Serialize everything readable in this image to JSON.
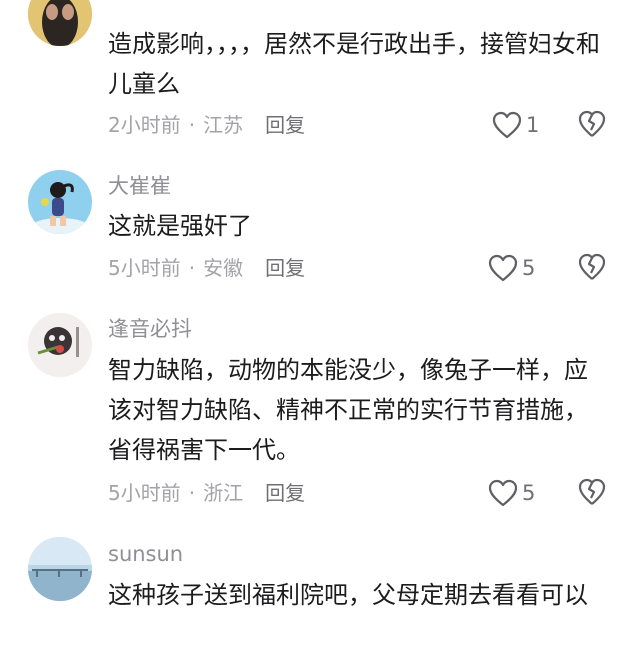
{
  "comments": [
    {
      "username": "",
      "text": "造成影响，，，，居然不是行政出手，接管妇女和儿童么",
      "time": "2小时前",
      "location": "江苏",
      "reply": "回复",
      "likes": "1"
    },
    {
      "username": "大崔崔",
      "text": "这就是强奸了",
      "time": "5小时前",
      "location": "安徽",
      "reply": "回复",
      "likes": "5"
    },
    {
      "username": "逢音必抖",
      "text": "智力缺陷，动物的本能没少，像兔子一样，应该对智力缺陷、精神不正常的实行节育措施，省得祸害下一代。",
      "time": "5小时前",
      "location": "浙江",
      "reply": "回复",
      "likes": "5"
    },
    {
      "username": "sunsun",
      "text": "这种孩子送到福利院吧，父母定期去看看可以",
      "time": "",
      "location": "",
      "reply": "",
      "likes": ""
    }
  ],
  "separator": "·",
  "icons": {
    "like": "heart-outline-icon",
    "dislike": "broken-heart-icon"
  },
  "colors": {
    "text": "#1c1c1e",
    "meta": "#a3a3a8",
    "icon": "#5f5f64"
  }
}
